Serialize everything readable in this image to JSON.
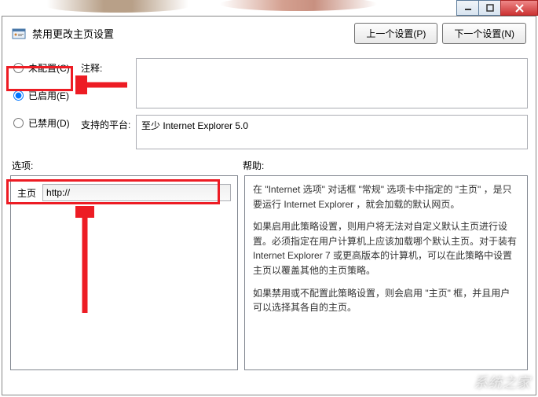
{
  "window": {
    "title": "禁用更改主页设置",
    "header_title": "禁用更改主页设置",
    "nav_prev": "上一个设置(P)",
    "nav_next": "下一个设置(N)"
  },
  "radios": {
    "not_configured": "未配置(C)",
    "enabled": "已启用(E)",
    "disabled": "已禁用(D)"
  },
  "fields": {
    "comment_label": "注释:",
    "comment_value": "",
    "platform_label": "支持的平台:",
    "platform_value": "至少 Internet Explorer 5.0"
  },
  "sections": {
    "options": "选项:",
    "help": "帮助:"
  },
  "options": {
    "homepage_label": "主页",
    "homepage_value": "http://"
  },
  "help": {
    "p1": "在 \"Internet 选项\" 对话框 \"常规\" 选项卡中指定的 \"主页\" ，是只要运行 Internet Explorer ，就会加载的默认网页。",
    "p2": "如果启用此策略设置，则用户将无法对自定义默认主页进行设置。必须指定在用户计算机上应该加载哪个默认主页。对于装有 Internet Explorer 7 或更高版本的计算机，可以在此策略中设置主页以覆盖其他的主页策略。",
    "p3": "如果禁用或不配置此策略设置，则会启用 \"主页\" 框，并且用户可以选择其各自的主页。"
  },
  "watermark": "系统之家"
}
